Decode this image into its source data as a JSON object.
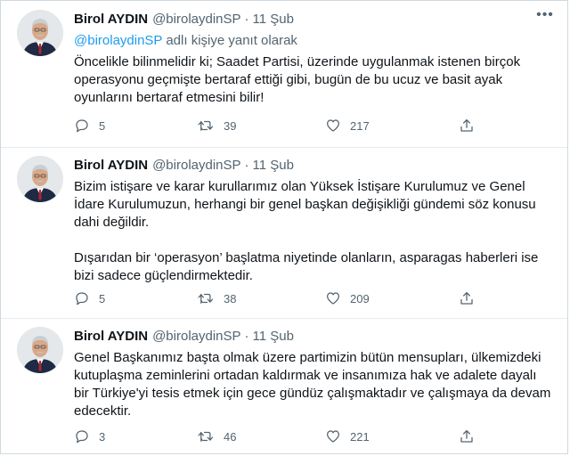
{
  "tweets": [
    {
      "name": "Birol AYDIN",
      "handle": "@birolaydinSP",
      "separator": "·",
      "date": "11 Şub",
      "reply_to": {
        "mention": "@birolaydinSP",
        "suffix": " adlı kişiye yanıt olarak"
      },
      "paragraphs": [
        "Öncelikle bilinmelidir ki; Saadet Partisi, üzerinde uygulanmak istenen birçok operasyonu geçmişte bertaraf ettiği gibi, bugün de bu ucuz ve basit ayak oyunlarını bertaraf etmesini bilir!"
      ],
      "replies": "5",
      "retweets": "39",
      "likes": "217"
    },
    {
      "name": "Birol AYDIN",
      "handle": "@birolaydinSP",
      "separator": "·",
      "date": "11 Şub",
      "paragraphs": [
        "Bizim istişare ve karar kurullarımız olan Yüksek İstişare Kurulumuz ve Genel İdare Kurulumuzun, herhangi bir genel başkan değişikliği gündemi söz konusu dahi değildir.",
        "Dışarıdan bir ‘operasyon’ başlatma niyetinde olanların, asparagas haberleri ise bizi sadece güçlendirmektedir."
      ],
      "replies": "5",
      "retweets": "38",
      "likes": "209"
    },
    {
      "name": "Birol AYDIN",
      "handle": "@birolaydinSP",
      "separator": "·",
      "date": "11 Şub",
      "paragraphs": [
        "Genel Başkanımız başta olmak üzere partimizin bütün mensupları, ülkemizdeki kutuplaşma zeminlerini ortadan kaldırmak ve insanımıza hak ve adalete dayalı bir Türkiye'yi tesis etmek için gece gündüz çalışmaktadır ve çalışmaya da devam edecektir."
      ],
      "replies": "3",
      "retweets": "46",
      "likes": "221"
    }
  ],
  "icons": {
    "more": "more-icon",
    "reply": "reply-icon",
    "retweet": "retweet-icon",
    "like": "heart-icon",
    "share": "share-icon"
  },
  "colors": {
    "text": "#0f1419",
    "secondary": "#536471",
    "link": "#1d9bf0",
    "divider": "#e6ecf0"
  }
}
